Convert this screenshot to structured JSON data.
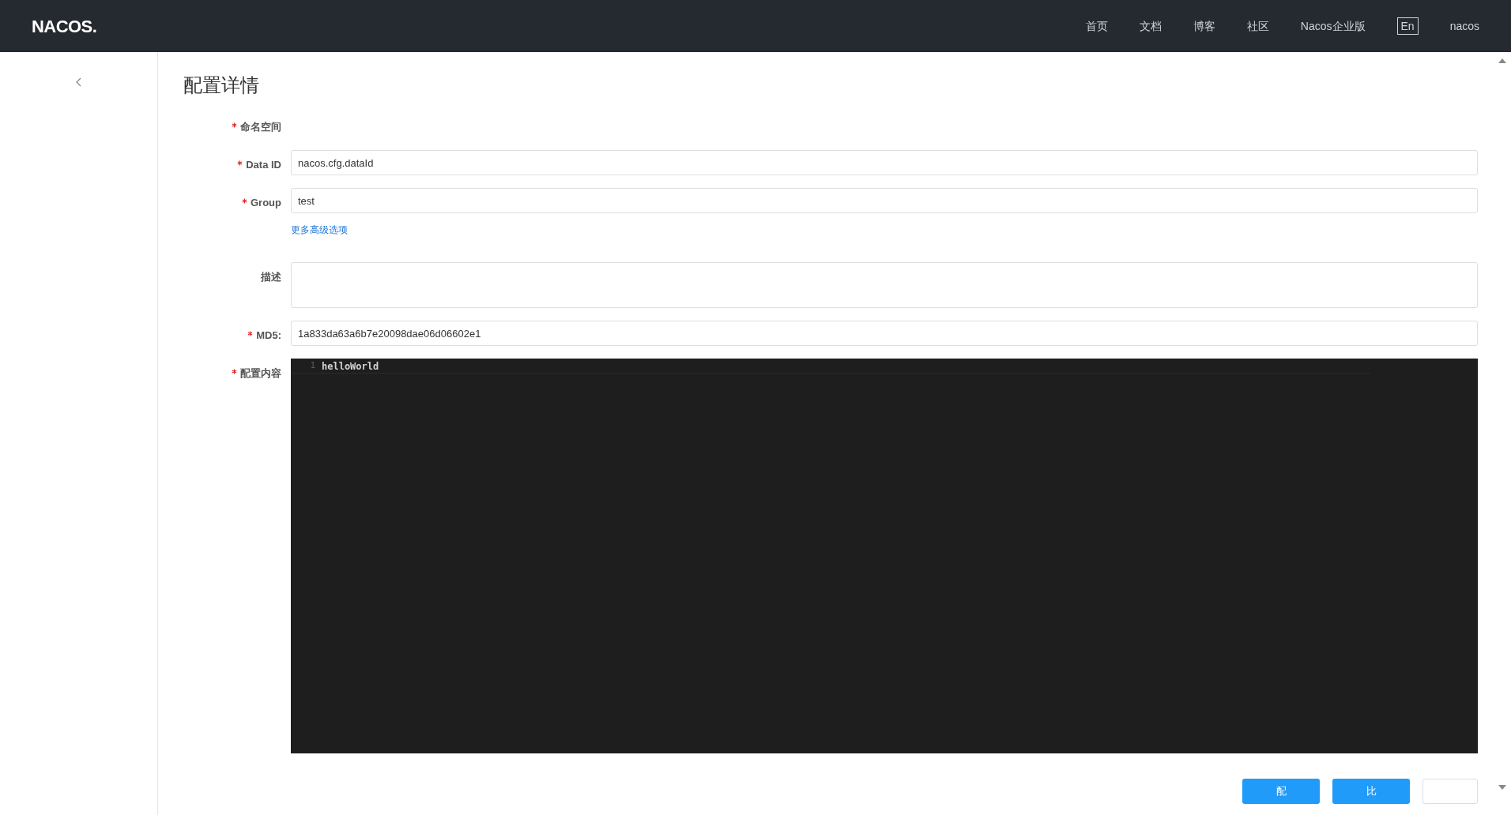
{
  "header": {
    "logo": "NACOS.",
    "nav": [
      {
        "label": "首页"
      },
      {
        "label": "文档"
      },
      {
        "label": "博客"
      },
      {
        "label": "社区"
      },
      {
        "label": "Nacos企业版"
      },
      {
        "label": "En",
        "kind": "boxed"
      },
      {
        "label": "nacos"
      }
    ]
  },
  "page": {
    "title": "配置详情",
    "fields": [
      {
        "kind": "empty",
        "label": "命名空间",
        "required": true
      },
      {
        "kind": "input",
        "label": "Data ID",
        "required": true,
        "value": "nacos.cfg.dataId"
      },
      {
        "kind": "input",
        "label": "Group",
        "required": true,
        "value": "test"
      },
      {
        "kind": "link",
        "text": "更多高级选项"
      },
      {
        "kind": "textarea",
        "label": "描述",
        "required": false
      },
      {
        "kind": "input",
        "label": "MD5:",
        "required": true,
        "value": "1a833da63a6b7e20098dae06d06602e1"
      },
      {
        "kind": "editor",
        "label": "配置内容",
        "required": true,
        "lines": [
          {
            "number": "1",
            "text": "helloWorld"
          }
        ]
      }
    ],
    "buttons": [
      {
        "label": "配",
        "kind": "primary"
      },
      {
        "label": "比",
        "kind": "primary"
      },
      {
        "kind": "normal"
      }
    ]
  }
}
